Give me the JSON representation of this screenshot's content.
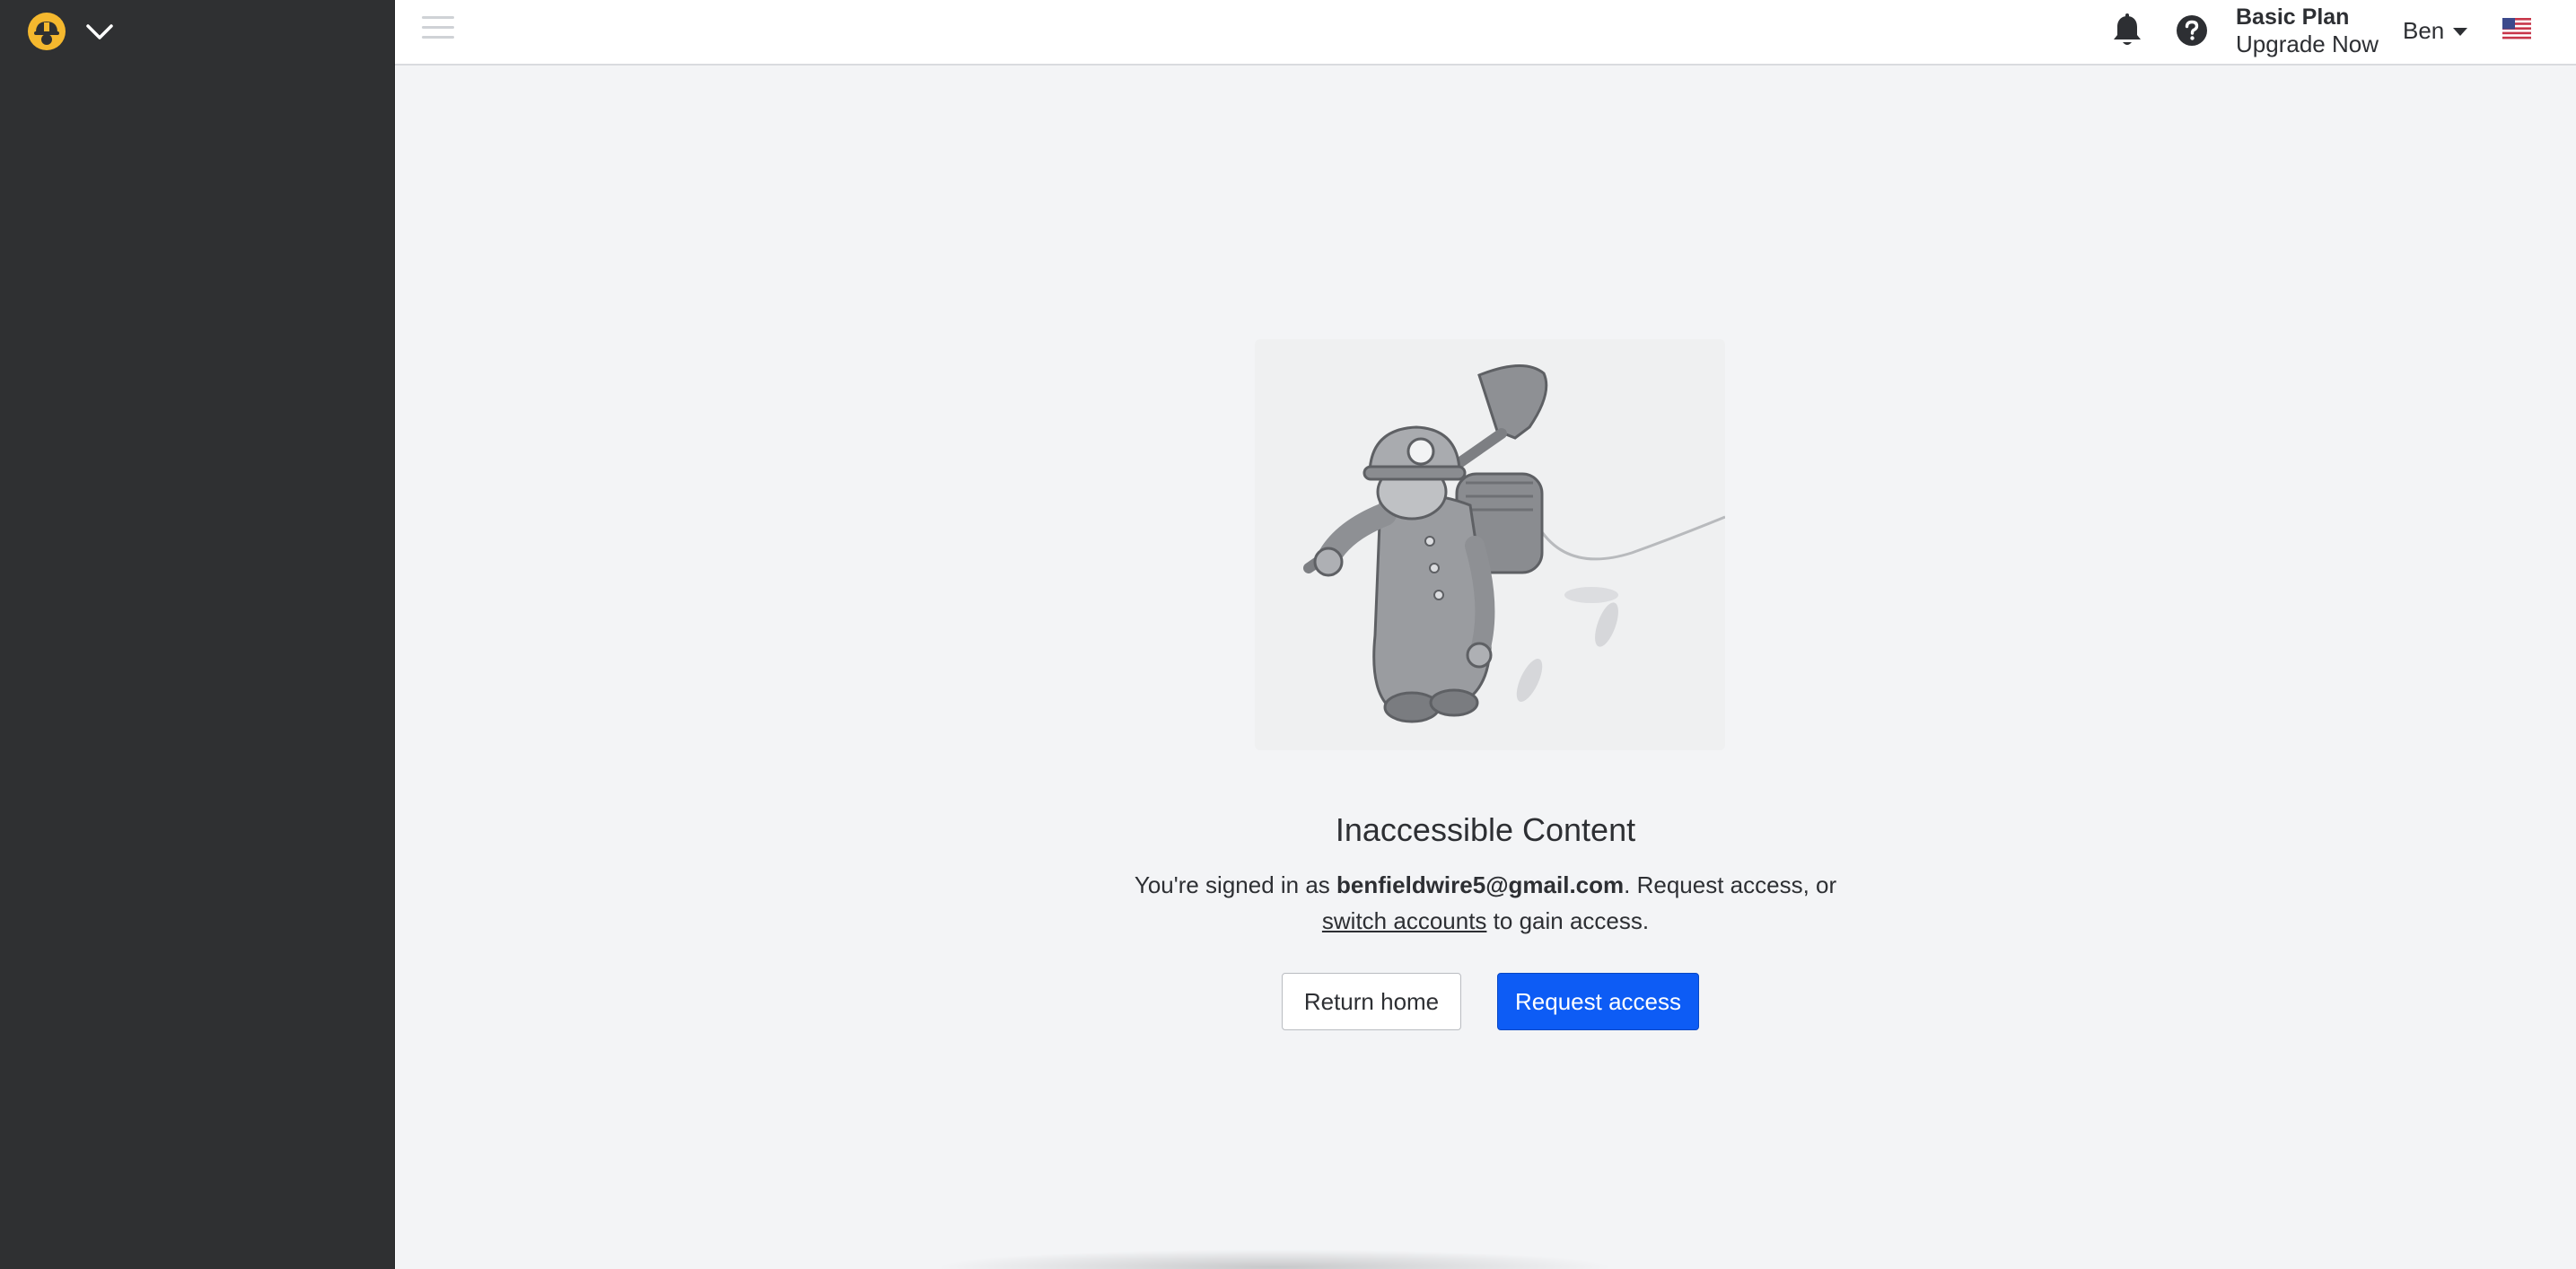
{
  "sidebar": {
    "logo_icon": "helmet-logo-icon",
    "menu_toggle_icon": "chevron-down-icon"
  },
  "topbar": {
    "hamburger_icon": "hamburger-menu-icon",
    "notifications_icon": "bell-icon",
    "help_icon": "question-circle-icon",
    "plan_name": "Basic Plan",
    "upgrade_label": "Upgrade Now",
    "user_name": "Ben",
    "language_icon": "us-flag-icon"
  },
  "main": {
    "illustration": "construction-worker-with-shovel",
    "title": "Inaccessible Content",
    "message_prefix": "You're signed in as ",
    "email": "benfieldwire5@gmail.com",
    "message_middle": ". Request access, or",
    "switch_link": "switch accounts",
    "message_suffix": " to gain access.",
    "return_home_label": "Return home",
    "request_access_label": "Request access"
  },
  "colors": {
    "sidebar_bg": "#2f3032",
    "page_bg": "#f3f4f6",
    "primary": "#0d5cf5",
    "logo_accent": "#f5b82e"
  }
}
